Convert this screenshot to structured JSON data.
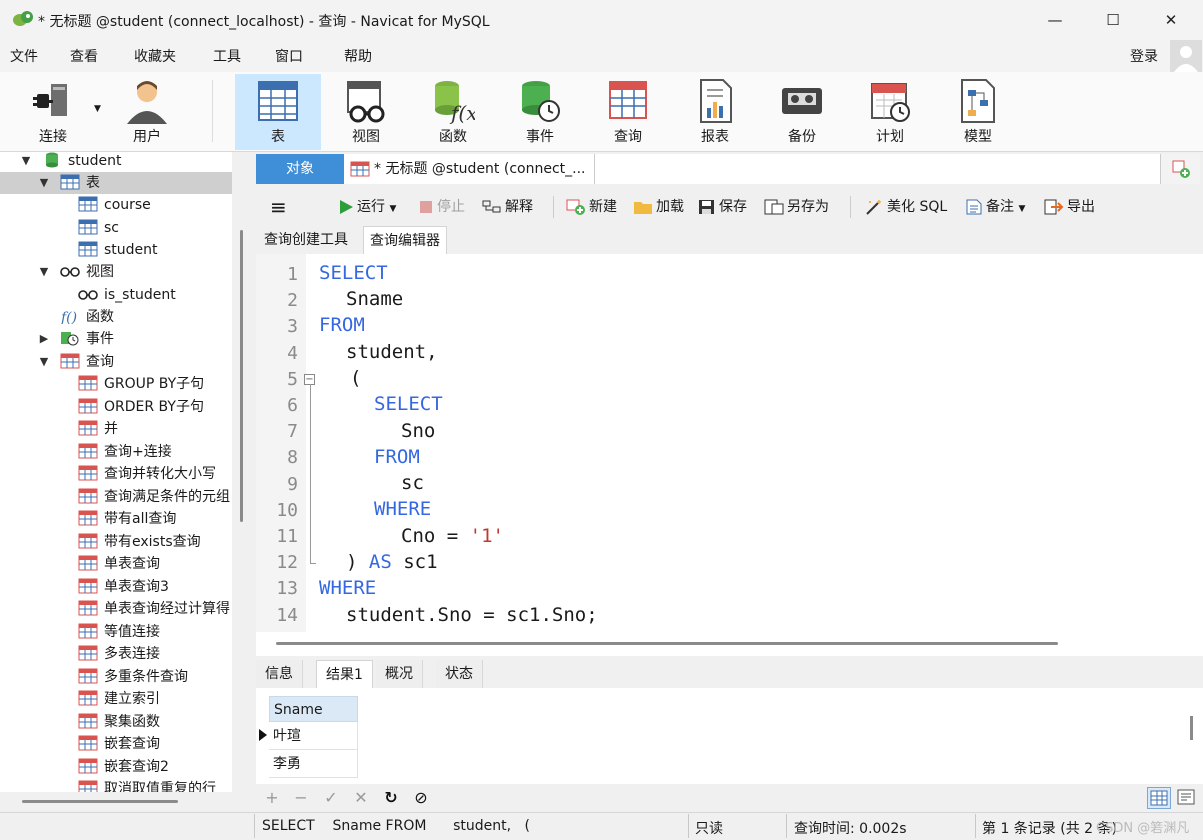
{
  "window": {
    "title": "* 无标题 @student (connect_localhost) - 查询 - Navicat for MySQL",
    "min_label": "—",
    "max_label": "☐",
    "close_label": "✕"
  },
  "menu": {
    "items": [
      "文件",
      "查看",
      "收藏夹",
      "工具",
      "窗口",
      "帮助"
    ],
    "login": "登录"
  },
  "toolbar": {
    "items": [
      "连接",
      "用户",
      "表",
      "视图",
      "函数",
      "事件",
      "查询",
      "报表",
      "备份",
      "计划",
      "模型"
    ]
  },
  "sidebar": {
    "db": "student",
    "tables_label": "表",
    "tables": [
      "course",
      "sc",
      "student"
    ],
    "views_label": "视图",
    "views": [
      "is_student"
    ],
    "functions_label": "函数",
    "events_label": "事件",
    "queries_label": "查询",
    "queries": [
      "GROUP BY子句",
      "ORDER BY子句",
      "并",
      "查询+连接",
      "查询并转化大小写",
      "查询满足条件的元组",
      "带有all查询",
      "带有exists查询",
      "单表查询",
      "单表查询3",
      "单表查询经过计算得",
      "等值连接",
      "多表连接",
      "多重条件查询",
      "建立索引",
      "聚集函数",
      "嵌套查询",
      "嵌套查询2",
      "取消取值重复的行"
    ]
  },
  "tabs": {
    "object": "对象",
    "query": "* 无标题 @student (connect_..."
  },
  "query_toolbar": {
    "run": "运行",
    "stop": "停止",
    "explain": "解释",
    "new": "新建",
    "load": "加载",
    "save": "保存",
    "save_as": "另存为",
    "beautify": "美化 SQL",
    "comment": "备注",
    "export": "导出"
  },
  "subtabs": {
    "builder": "查询创建工具",
    "editor": "查询编辑器"
  },
  "code": {
    "lines": [
      "1",
      "2",
      "3",
      "4",
      "5",
      "6",
      "7",
      "8",
      "9",
      "10",
      "11",
      "12",
      "13",
      "14"
    ],
    "select": "SELECT",
    "sname": "Sname",
    "from": "FROM",
    "student_comma": "student,",
    "paren_open": "(",
    "sno": "Sno",
    "sc": "sc",
    "where": "WHERE",
    "cno_eq": "Cno = ",
    "cno_val": "'1'",
    "paren_close": ") ",
    "as": "AS",
    "sc1": " sc1",
    "join_cond": "student.Sno = sc1.Sno;"
  },
  "results": {
    "tabs": [
      "信息",
      "结果1",
      "概况",
      "状态"
    ],
    "column": "Sname",
    "rows": [
      "叶瑄",
      "李勇"
    ]
  },
  "status": {
    "sql_preview": "SELECT    Sname FROM      student,   (",
    "mode": "只读",
    "query_time": "查询时间: 0.002s",
    "records": "第 1 条记录 (共 2 条)",
    "watermark": "CSDN @箬渊凡"
  },
  "colors": {
    "accent": "#3f8fd8",
    "selected_toolbar": "#cce8ff",
    "keyword": "#3568e0",
    "string": "#c0392b"
  }
}
